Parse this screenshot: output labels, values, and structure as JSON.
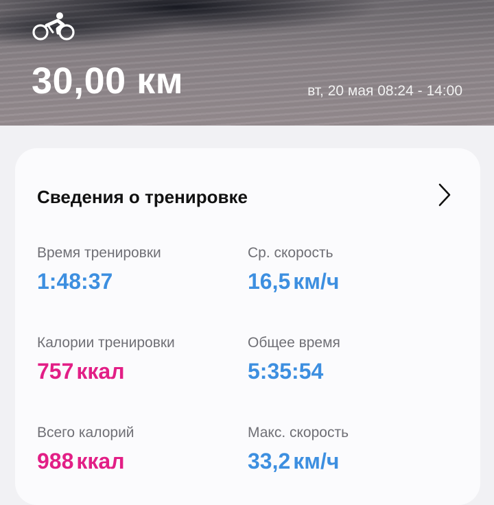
{
  "header": {
    "activity_icon": "cycling-icon",
    "distance": "30,00 км",
    "date_range": "вт, 20 мая 08:24 - 14:00"
  },
  "card": {
    "title": "Сведения о тренировке",
    "chevron_icon": "chevron-right-icon",
    "stats": [
      {
        "label": "Время тренировки",
        "value": "1:48:37",
        "unit": "",
        "color": "#3d8fe0"
      },
      {
        "label": "Ср. скорость",
        "value": "16,5",
        "unit": "км/ч",
        "color": "#3d8fe0"
      },
      {
        "label": "Калории тренировки",
        "value": "757",
        "unit": "ккал",
        "color": "#e21f86"
      },
      {
        "label": "Общее время",
        "value": "5:35:54",
        "unit": "",
        "color": "#3d8fe0"
      },
      {
        "label": "Всего калорий",
        "value": "988",
        "unit": "ккал",
        "color": "#e21f86"
      },
      {
        "label": "Макс. скорость",
        "value": "33,2",
        "unit": "км/ч",
        "color": "#3d8fe0"
      }
    ]
  }
}
